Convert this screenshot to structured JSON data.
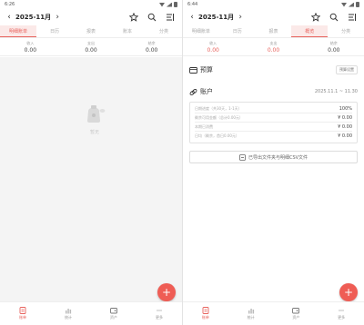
{
  "left": {
    "status": {
      "time": "6:26"
    },
    "header": {
      "month": "2025-11月"
    },
    "tabs": [
      {
        "label": "明细账单",
        "active": true
      },
      {
        "label": "日历",
        "active": false
      },
      {
        "label": "报表",
        "active": false
      },
      {
        "label": "账本",
        "active": false
      },
      {
        "label": "分类",
        "active": false
      }
    ],
    "summary": [
      {
        "label": "收入",
        "value": "0.00",
        "accent": false
      },
      {
        "label": "支出",
        "value": "0.00",
        "accent": false
      },
      {
        "label": "结余",
        "value": "0.00",
        "accent": false
      }
    ],
    "empty_text": "暂无",
    "fab": "+",
    "bottom_nav": [
      {
        "label": "账单",
        "icon": "bill-icon",
        "active": true
      },
      {
        "label": "统计",
        "icon": "stats-icon",
        "active": false
      },
      {
        "label": "资产",
        "icon": "wallet-icon",
        "active": false
      },
      {
        "label": "更多",
        "icon": "more-icon",
        "active": false
      }
    ]
  },
  "right": {
    "status": {
      "time": "6:44"
    },
    "header": {
      "month": "2025-11月"
    },
    "tabs": [
      {
        "label": "明细账单",
        "active": false
      },
      {
        "label": "日历",
        "active": false
      },
      {
        "label": "报表",
        "active": false
      },
      {
        "label": "概览",
        "active": true
      },
      {
        "label": "分类",
        "active": false
      }
    ],
    "summary": [
      {
        "label": "收入",
        "value": "0.00",
        "accent": true
      },
      {
        "label": "支出",
        "value": "0.00",
        "accent": true
      },
      {
        "label": "结余",
        "value": "0.00",
        "accent": false
      }
    ],
    "budget": {
      "title": "预算",
      "button": "预算设置"
    },
    "account": {
      "title": "账户",
      "date_range": "2025.11.1 ~ 11.30",
      "rows": [
        {
          "label": "日期进度（共30天，1-1天）",
          "value": "100%"
        },
        {
          "label": "剩余可用金额（总计0.00元）",
          "value": "¥ 0.00"
        },
        {
          "label": "本期已消费",
          "value": "¥ 0.00"
        },
        {
          "label": "日均（剩余，首日0.00元）",
          "value": "¥ 0.00"
        }
      ]
    },
    "csv_button": "已导出文件夹与明细CSV文件",
    "fab": "+",
    "bottom_nav": [
      {
        "label": "账单",
        "icon": "bill-icon",
        "active": true
      },
      {
        "label": "统计",
        "icon": "stats-icon",
        "active": false
      },
      {
        "label": "资产",
        "icon": "wallet-icon",
        "active": false
      },
      {
        "label": "更多",
        "icon": "more-icon",
        "active": false
      }
    ]
  },
  "colors": {
    "accent": "#e8635d",
    "fab": "#ef5d55",
    "empty_bg": "#f4f4f4"
  }
}
